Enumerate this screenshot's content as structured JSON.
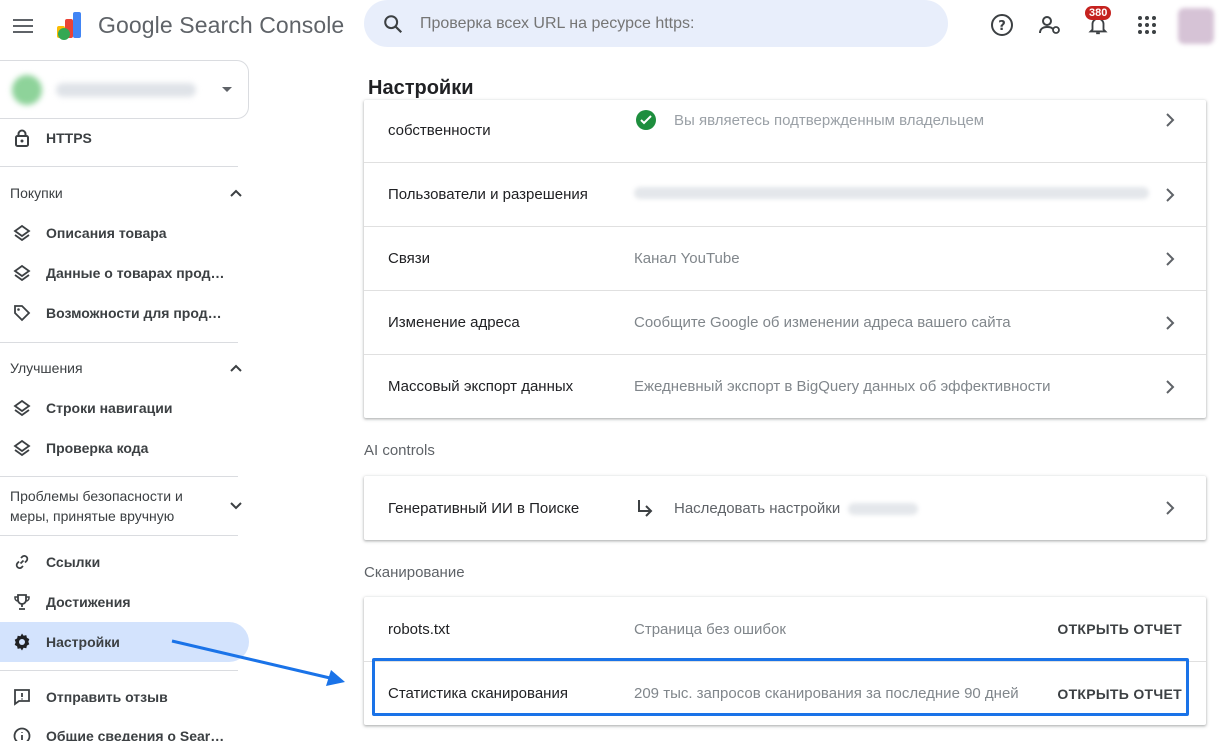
{
  "header": {
    "app_title": "Google Search Console",
    "search_placeholder": "Проверка всех URL на ресурсе https:",
    "notifications_count": "380"
  },
  "sidebar": {
    "items_top": [
      {
        "label": "HTTPS",
        "icon": "lock-icon"
      }
    ],
    "sections": [
      {
        "title": "Покупки",
        "items": [
          {
            "label": "Описания товара",
            "icon": "layers-icon"
          },
          {
            "label": "Данные о товарах прод…",
            "icon": "layers-icon"
          },
          {
            "label": "Возможности для прод…",
            "icon": "tag-icon"
          }
        ]
      },
      {
        "title": "Улучшения",
        "items": [
          {
            "label": "Строки навигации",
            "icon": "layers-icon"
          },
          {
            "label": "Проверка кода",
            "icon": "layers-icon"
          }
        ]
      },
      {
        "title": "Проблемы безопасности и меры, принятые вручную",
        "title_line1": "Проблемы безопасности и",
        "title_line2": "меры, принятые вручную",
        "items": []
      }
    ],
    "items_bottom": [
      {
        "label": "Ссылки",
        "icon": "link-icon"
      },
      {
        "label": "Достижения",
        "icon": "trophy-icon"
      },
      {
        "label": "Настройки",
        "icon": "gear-icon",
        "active": true
      }
    ],
    "items_footer": [
      {
        "label": "Отправить отзыв",
        "icon": "feedback-icon"
      },
      {
        "label": "Общие сведения о Sear…",
        "icon": "info-icon"
      }
    ]
  },
  "main": {
    "title": "Настройки",
    "property_card": {
      "rows": [
        {
          "label": "собственности",
          "value": "Вы являетесь подтвержденным владельцем"
        },
        {
          "label": "Пользователи и разрешения",
          "value": ""
        },
        {
          "label": "Связи",
          "value": "Канал YouTube"
        },
        {
          "label": "Изменение адреса",
          "value": "Сообщите Google об изменении адреса вашего сайта"
        },
        {
          "label": "Массовый экспорт данных",
          "value": "Ежедневный экспорт в BigQuery данных об эффективности"
        }
      ]
    },
    "ai_controls": {
      "group_label": "AI controls",
      "row": {
        "label": "Генеративный ИИ в Поиске",
        "value": "Наследовать настройки"
      }
    },
    "crawling": {
      "group_label": "Сканирование",
      "rows": [
        {
          "label": "robots.txt",
          "value": "Страница без ошибок",
          "action": "ОТКРЫТЬ ОТЧЕТ"
        },
        {
          "label": "Статистика сканирования",
          "value": "209 тыс. запросов сканирования за последние 90 дней",
          "action": "ОТКРЫТЬ ОТЧЕТ"
        }
      ]
    }
  },
  "colors": {
    "accent": "#1a73e8",
    "active_nav_bg": "#d3e3fd",
    "badge": "#c5221f",
    "verified_green": "#1e8e3e"
  }
}
